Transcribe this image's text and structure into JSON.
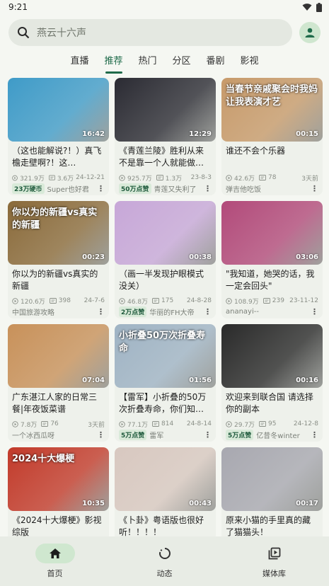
{
  "status": {
    "time": "9:21"
  },
  "search": {
    "placeholder": "燕云十六声"
  },
  "tabs": [
    "直播",
    "推荐",
    "热门",
    "分区",
    "番剧",
    "影视"
  ],
  "active_tab": "推荐",
  "cards": [
    {
      "title": "（这也能解说?！）真飞檐走壁啊?！这…",
      "duration": "16:42",
      "views": "321.9万",
      "comments": "3.6万",
      "date": "24-12-21",
      "badge": "23万硬币",
      "uploader": "Super也好君"
    },
    {
      "title": "《青莲兰陵》胜利从来不是靠一个人就能做…",
      "duration": "12:29",
      "views": "925.7万",
      "comments": "1.3万",
      "date": "23-8-3",
      "badge": "50万点赞",
      "uploader": "青莲又失利了"
    },
    {
      "title": "谁还不会个乐器",
      "duration": "00:15",
      "views": "42.6万",
      "comments": "78",
      "date": "3天前",
      "badge": "",
      "uploader": "弹吉他吃饭"
    },
    {
      "title": "你以为的新疆vs真实的新疆",
      "duration": "00:23",
      "views": "120.6万",
      "comments": "398",
      "date": "24-7-6",
      "badge": "",
      "uploader": "中国旅游攻略"
    },
    {
      "title": "（画一半发现护眼模式没关）",
      "duration": "00:38",
      "views": "46.8万",
      "comments": "175",
      "date": "24-8-28",
      "badge": "2万点赞",
      "uploader": "华丽的FH大帝"
    },
    {
      "title": "\"我知道，她哭的话，我一定会回头\"",
      "duration": "03:06",
      "views": "108.9万",
      "comments": "239",
      "date": "23-11-12",
      "badge": "",
      "uploader": "ananayi--"
    },
    {
      "title": "广东湛江人家的日常三餐|年夜饭菜谱",
      "duration": "07:04",
      "views": "7.8万",
      "comments": "76",
      "date": "3天前",
      "badge": "",
      "uploader": "一个冰西瓜呀"
    },
    {
      "title": "【雷军】小折叠的50万次折叠寿命，你们知…",
      "duration": "01:56",
      "views": "77.1万",
      "comments": "814",
      "date": "24-8-14",
      "badge": "5万点赞",
      "uploader": "雷军"
    },
    {
      "title": "欢迎来到联合国 请选择你的副本",
      "duration": "00:16",
      "views": "29.7万",
      "comments": "95",
      "date": "24-12-8",
      "badge": "5万点赞",
      "uploader": "亿昔冬winter"
    },
    {
      "title": "《2024十大爆梗》影视综版",
      "duration": "10:35",
      "views": "",
      "comments": "",
      "date": "",
      "badge": "",
      "uploader": ""
    },
    {
      "title": "《卜卦》粤语版也很好听！！！！",
      "duration": "00:43",
      "views": "",
      "comments": "",
      "date": "",
      "badge": "",
      "uploader": ""
    },
    {
      "title": "原来小猫的手里真的藏了猫猫头！",
      "duration": "00:17",
      "views": "",
      "comments": "",
      "date": "",
      "badge": "",
      "uploader": ""
    }
  ],
  "thumb_text": {
    "t4": "你以为的新疆vs真实的新疆",
    "t10": "2024十大爆梗",
    "t3": "当春节亲戚聚会时我妈让我表演才艺",
    "t8": "小折叠50万次折叠寿命"
  },
  "thumb_colors": [
    "#3f9bc8",
    "#2b2b33",
    "#c79a6a",
    "#8a6a3a",
    "#c7a7d8",
    "#b24a7a",
    "#c8915a",
    "#9fb3c4",
    "#2a2a2a",
    "#c23a2a",
    "#d8c8c0",
    "#a8a8b0"
  ],
  "nav": [
    {
      "label": "首页",
      "icon": "home-icon"
    },
    {
      "label": "动态",
      "icon": "activity-icon"
    },
    {
      "label": "媒体库",
      "icon": "library-icon"
    }
  ],
  "accent": "#1f6b4a"
}
